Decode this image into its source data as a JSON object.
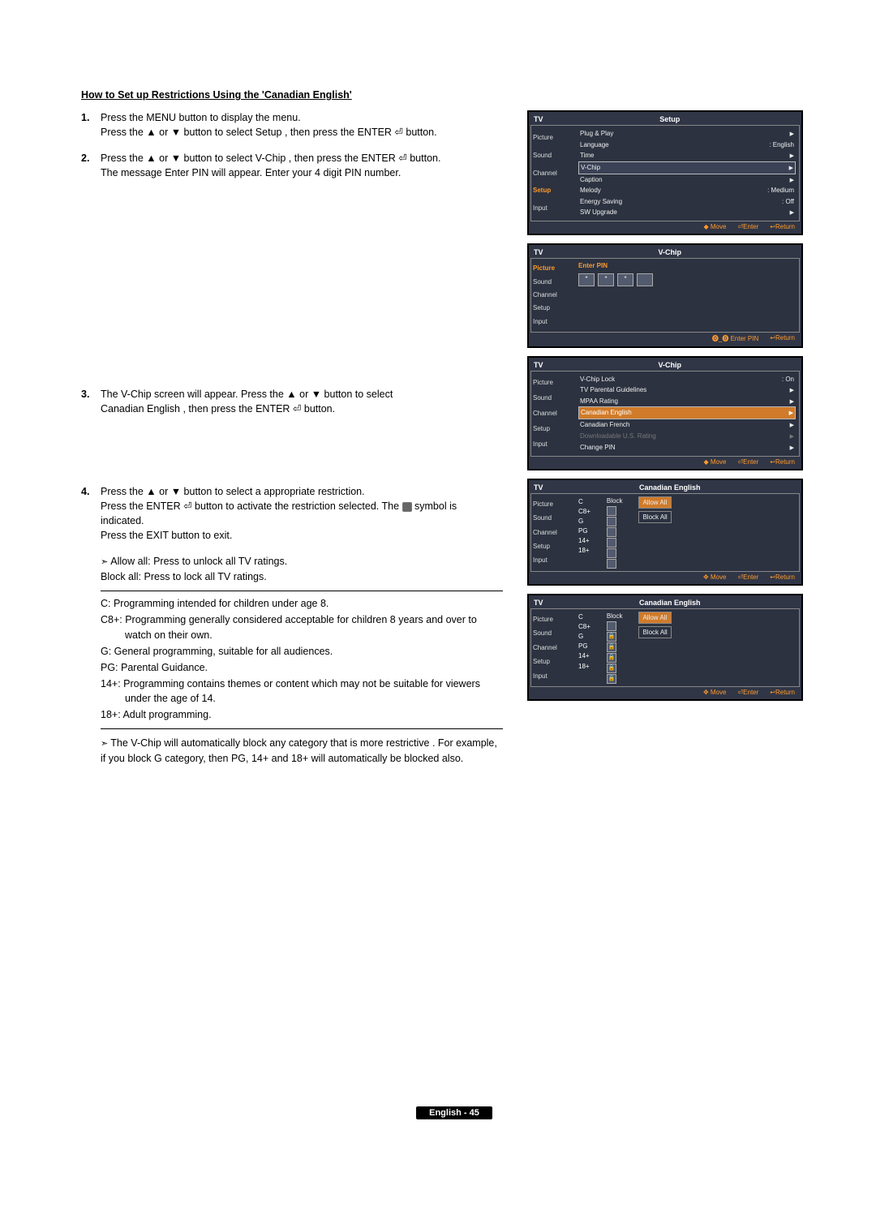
{
  "headline": "How to Set up Restrictions Using the 'Canadian English'",
  "steps": {
    "s1a": "Press the MENU button to display the menu.",
    "s1b": "Press the ▲ or ▼ button to select  Setup , then press the ENTER ⏎ button.",
    "s2a": "Press the ▲ or ▼ button to select  V-Chip , then press the ENTER ⏎ button.",
    "s2b": "The message  Enter PIN  will appear. Enter your 4 digit PIN number.",
    "s3a": "The  V-Chip  screen will appear. Press the  ▲ or ▼ button to select",
    "s3b": "Canadian English , then press the ENTER ⏎ button.",
    "s4a": "Press the ▲ or ▼ button to select a appropriate restriction.",
    "s4b_pre": "Press the ENTER ⏎ button to activate the restriction selected. The ",
    "s4b_post": " symbol is indicated.",
    "s4c": "Press the EXIT button to exit.",
    "s4d": "Allow all: Press to unlock all TV ratings.",
    "s4e": "Block all: Press to lock all TV ratings."
  },
  "defs": {
    "c": "C: Programming intended for children under age 8.",
    "c8": "C8+: Programming generally considered acceptable for children 8 years and over to watch on their own.",
    "g": "G: General programming, suitable for all audiences.",
    "pg": "PG: Parental Guidance.",
    "p14": "14+: Programming contains themes or content which may not be suitable for viewers under the age of 14.",
    "p18": "18+: Adult programming."
  },
  "auto_note": "The V-Chip will automatically block any category that is  more restrictive . For example, if you block G category, then PG, 14+ and 18+ will automatically be blocked also.",
  "footer": "English - 45",
  "osd_sidebar": [
    "Picture",
    "Sound",
    "Channel",
    "Setup",
    "Input"
  ],
  "osd1": {
    "tv": "TV",
    "title": "Setup",
    "rows": [
      {
        "l": "Plug & Play",
        "r": ""
      },
      {
        "l": "Language",
        "r": ": English"
      },
      {
        "l": "Time",
        "r": ""
      },
      {
        "l": "V-Chip",
        "r": "",
        "hl": true
      },
      {
        "l": "Caption",
        "r": ""
      },
      {
        "l": "Melody",
        "r": ": Medium"
      },
      {
        "l": "Energy Saving",
        "r": ": Off"
      },
      {
        "l": "SW Upgrade",
        "r": ""
      }
    ],
    "footer": [
      "◆ Move",
      "⏎Enter",
      "↩Return"
    ]
  },
  "osd2": {
    "tv": "TV",
    "title": "V-Chip",
    "enter_pin": "Enter PIN",
    "footer": [
      "⓿_⓿ Enter PIN",
      "↩Return"
    ]
  },
  "osd3": {
    "tv": "TV",
    "title": "V-Chip",
    "rows": [
      {
        "l": "V-Chip Lock",
        "r": ": On"
      },
      {
        "l": "TV Parental Guidelines",
        "r": ""
      },
      {
        "l": "MPAA Rating",
        "r": ""
      },
      {
        "l": "Canadian English",
        "r": "",
        "hl": true
      },
      {
        "l": "Canadian French",
        "r": ""
      },
      {
        "l": "Downloadable U.S. Rating",
        "r": "",
        "dim": true
      },
      {
        "l": "Change PIN",
        "r": ""
      }
    ],
    "footer": [
      "◆ Move",
      "⏎Enter",
      "↩Return"
    ]
  },
  "osd4": {
    "tv": "TV",
    "title": "Canadian English",
    "block": "Block",
    "labels": [
      "C",
      "C8+",
      "G",
      "PG",
      "14+",
      "18+"
    ],
    "btns": [
      "Allow All",
      "Block All"
    ],
    "footer": [
      "✥ Move",
      "⏎Enter",
      "↩Return"
    ]
  },
  "osd5": {
    "tv": "TV",
    "title": "Canadian English",
    "block": "Block",
    "labels": [
      "C",
      "C8+",
      "G",
      "PG",
      "14+",
      "18+"
    ],
    "btns": [
      "Allow All",
      "Block All"
    ],
    "footer": [
      "✥ Move",
      "⏎Enter",
      "↩Return"
    ]
  }
}
